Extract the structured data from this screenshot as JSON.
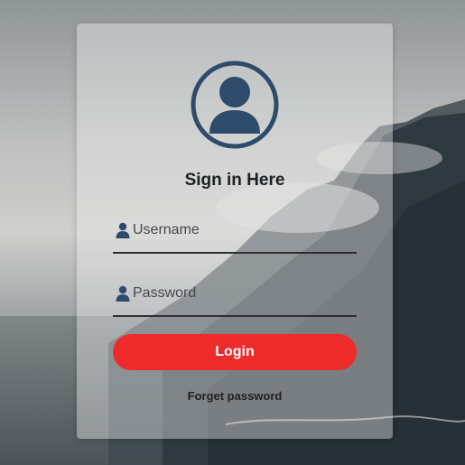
{
  "form": {
    "title": "Sign in Here",
    "username_placeholder": "Username",
    "username_value": "",
    "password_placeholder": "Password",
    "password_value": "",
    "login_label": "Login",
    "forgot_label": "Forget password"
  },
  "icons": {
    "avatar": "user-circle-icon",
    "username": "user-icon",
    "password": "user-icon"
  },
  "colors": {
    "accent": "#ee2b2b",
    "avatar": "#2e4b6c",
    "field_icon": "#2e4b6c",
    "text": "#1e2124",
    "button_text": "#ffffff"
  }
}
